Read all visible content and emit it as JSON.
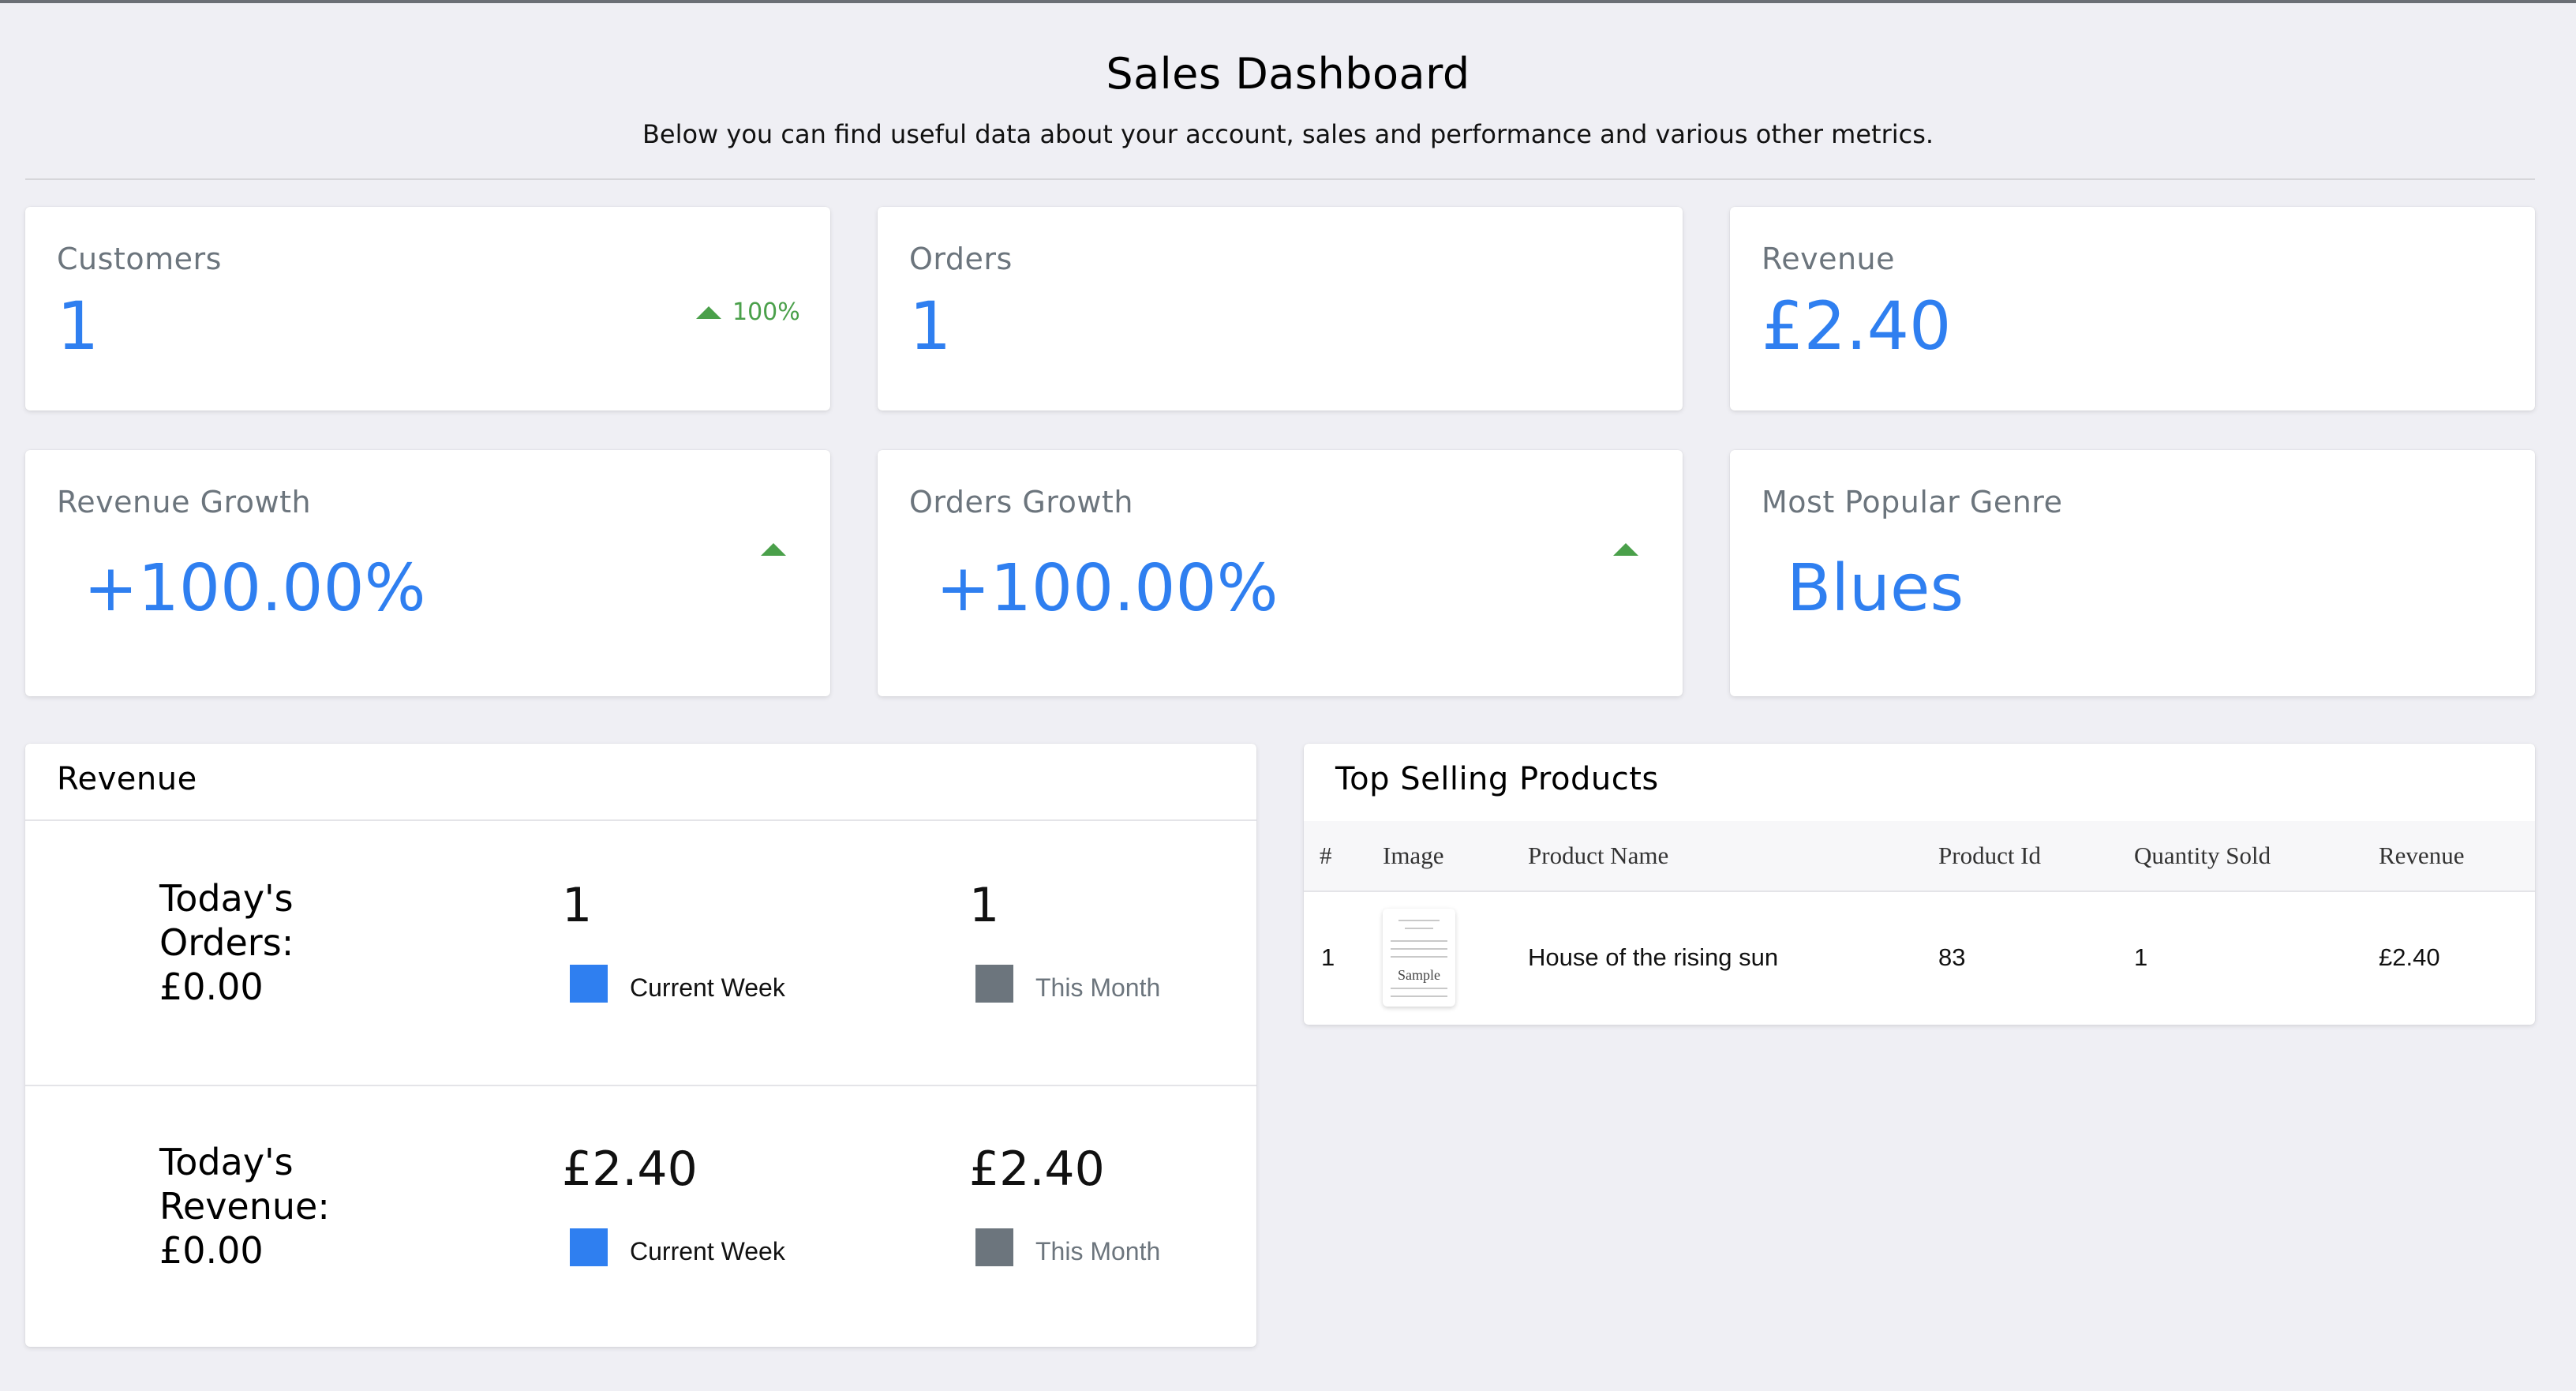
{
  "header": {
    "title": "Sales Dashboard",
    "subtitle": "Below you can find useful data about your account, sales and performance and various other metrics."
  },
  "stats": {
    "customers": {
      "label": "Customers",
      "value": "1",
      "trend": "100%"
    },
    "orders": {
      "label": "Orders",
      "value": "1"
    },
    "revenue": {
      "label": "Revenue",
      "value": "£2.40"
    },
    "revenue_growth": {
      "label": "Revenue Growth",
      "value": "+100.00%"
    },
    "orders_growth": {
      "label": "Orders Growth",
      "value": "+100.00%"
    },
    "popular_genre": {
      "label": "Most Popular Genre",
      "value": "Blues"
    }
  },
  "revenue_panel": {
    "title": "Revenue",
    "orders_row": {
      "label_line1": "Today's",
      "label_line2": "Orders:",
      "label_line3": "£0.00",
      "current_week_value": "1",
      "this_month_value": "1"
    },
    "revenue_row": {
      "label_line1": "Today's",
      "label_line2": "Revenue:",
      "label_line3": "£0.00",
      "current_week_value": "£2.40",
      "this_month_value": "£2.40"
    },
    "legend": {
      "current_week": "Current Week",
      "this_month": "This Month"
    },
    "colors": {
      "current_week": "#2f7ff0",
      "this_month": "#6c757d"
    }
  },
  "top_products": {
    "title": "Top Selling Products",
    "columns": [
      "#",
      "Image",
      "Product Name",
      "Product Id",
      "Quantity Sold",
      "Revenue"
    ],
    "rows": [
      {
        "index": "1",
        "image_icon": "sheet-music-thumbnail",
        "image_text": "Sample",
        "name": "House of the rising sun",
        "product_id": "83",
        "quantity": "1",
        "revenue": "£2.40"
      }
    ]
  },
  "colors": {
    "accent": "#2f7ff0",
    "trend_up": "#4aa04a",
    "muted": "#6c757d",
    "background": "#efeff4"
  }
}
